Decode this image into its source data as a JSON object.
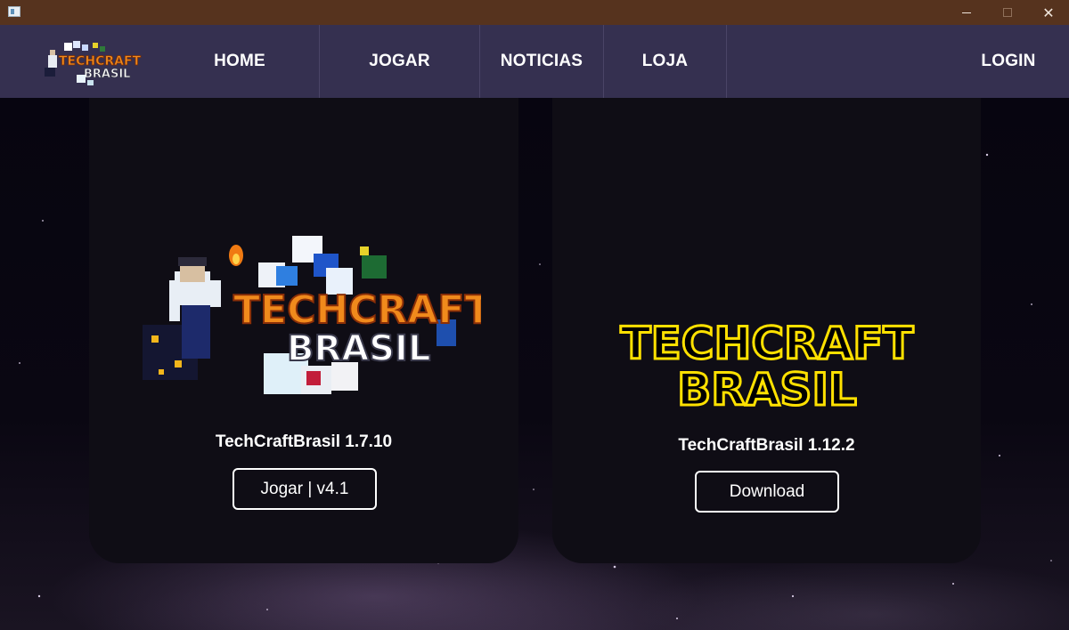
{
  "window": {
    "minimize_glyph": "—",
    "maximize_glyph": "☐",
    "close_glyph": "✕"
  },
  "nav": {
    "logo_alt": "TechCraft Brasil logo",
    "logo_line1": "TECHCRAFT",
    "logo_line2": "BRASIL",
    "items": [
      {
        "label": "HOME"
      },
      {
        "label": "JOGAR"
      },
      {
        "label": "NOTICIAS"
      },
      {
        "label": "LOJA"
      }
    ],
    "login": "LOGIN"
  },
  "cards": [
    {
      "logo_line1": "TECHCRAFT",
      "logo_line2": "BRASIL",
      "title": "TechCraftBrasil 1.7.10",
      "button": "Jogar | v4.1"
    },
    {
      "logo_line1": "TECHCRAFT",
      "logo_line2": "BRASIL",
      "title": "TechCraftBrasil 1.12.2",
      "button": "Download"
    }
  ],
  "colors": {
    "titlebar": "#56331e",
    "navbar": "#353050",
    "card": "#0f0d15",
    "logo_orange": "#f08a1c",
    "logo_yellow": "#ffe100"
  }
}
